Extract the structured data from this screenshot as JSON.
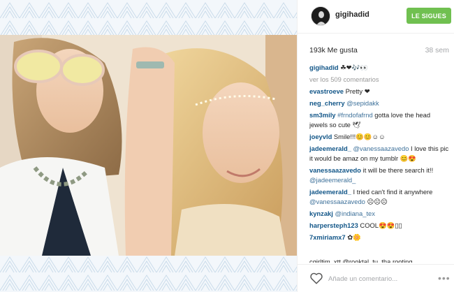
{
  "post": {
    "username": "gigihadid",
    "follow_label": "LE SIGUES",
    "likes": "193k Me gusta",
    "age": "38 sem",
    "caption_user": "gigihadid",
    "caption_text": "☘❤🎶👀",
    "more_comments": "ver los 509 comentarios"
  },
  "comments": [
    {
      "user": "evastroeve",
      "text": " Pretty ❤"
    },
    {
      "user": "neg_cherry",
      "mention": " @sepidakk",
      "text": ""
    },
    {
      "user": "sm3mily",
      "mention": " #frndofafrnd",
      "text": " gotta love the head jewels so cute 🕊"
    },
    {
      "user": "joeyvld",
      "text": " Smile!!!😊😊☺☺"
    },
    {
      "user": "jadeemerald_",
      "mention": " @vanessaazavedo",
      "text": " I love this pic it would be amaz on my tumblr 😊😍"
    },
    {
      "user": "vanessaazavedo",
      "text": " it will be there search it!! ",
      "mention2": "@jadeemerald_"
    },
    {
      "user": "jadeemerald_",
      "text": " I tried can't find it anywhere ",
      "mention2": "@vanessaazavedo",
      "text2": " ☹☹☹"
    },
    {
      "user": "kynzakj",
      "mention": " @indiana_tex",
      "text": ""
    },
    {
      "user": "harpersteph123",
      "text": " COOL😍😍▯▯"
    },
    {
      "user": "7xmiriamx7",
      "text": " ✿🌼"
    }
  ],
  "cutoff_line": "cgirltim_xtt @rooktal_tu_tha rooting",
  "footer": {
    "heart_icon": "heart-outline-icon",
    "placeholder": "Añade un comentario...",
    "more_icon": "more-options-icon"
  },
  "colors": {
    "follow": "#70c050",
    "username": "#125688",
    "mention": "#3f729b"
  }
}
